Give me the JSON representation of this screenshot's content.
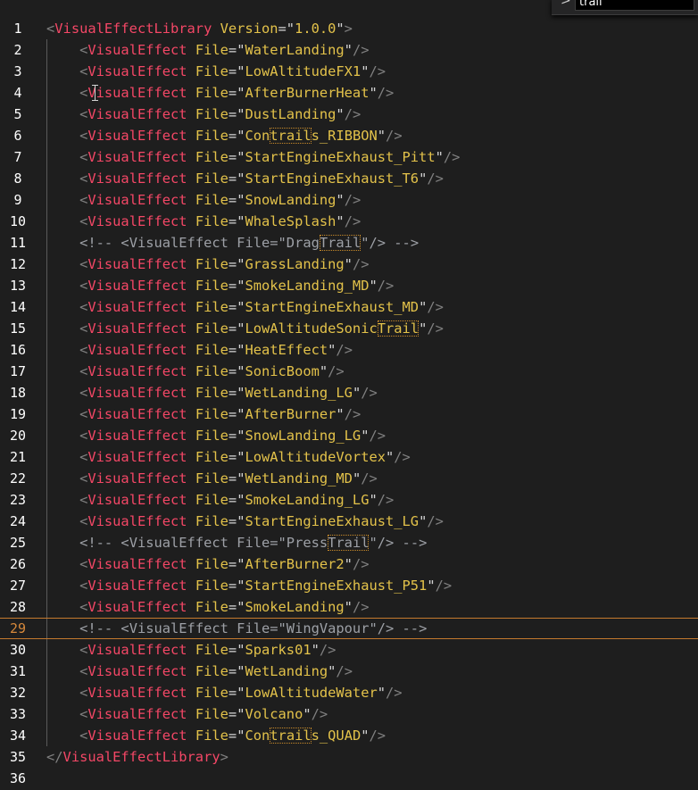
{
  "find": {
    "query": "trail",
    "toggle_icon": "chevron-right-icon",
    "toggle_glyph": ">"
  },
  "current_line": 29,
  "colors": {
    "background": "#1e1e1e",
    "tag": "#f44766",
    "attribute": "#e3c24a",
    "comment": "#9da0a6",
    "current_line_number": "#d7893b"
  },
  "lines": [
    {
      "n": "1",
      "kind": "open",
      "tag": "VisualEffectLibrary",
      "attr": "Version",
      "value": "1.0.0"
    },
    {
      "n": "2",
      "kind": "item",
      "tag": "VisualEffect",
      "attr": "File",
      "value": "WaterLanding"
    },
    {
      "n": "3",
      "kind": "item",
      "tag": "VisualEffect",
      "attr": "File",
      "value": "LowAltitudeFX1"
    },
    {
      "n": "4",
      "kind": "item",
      "tag": "VisualEffect",
      "attr": "File",
      "value": "AfterBurnerHeat"
    },
    {
      "n": "5",
      "kind": "item",
      "tag": "VisualEffect",
      "attr": "File",
      "value": "DustLanding"
    },
    {
      "n": "6",
      "kind": "item",
      "tag": "VisualEffect",
      "attr": "File",
      "value": "Contrails_RIBBON",
      "match": "trail"
    },
    {
      "n": "7",
      "kind": "item",
      "tag": "VisualEffect",
      "attr": "File",
      "value": "StartEngineExhaust_Pitt"
    },
    {
      "n": "8",
      "kind": "item",
      "tag": "VisualEffect",
      "attr": "File",
      "value": "StartEngineExhaust_T6"
    },
    {
      "n": "9",
      "kind": "item",
      "tag": "VisualEffect",
      "attr": "File",
      "value": "SnowLanding"
    },
    {
      "n": "10",
      "kind": "item",
      "tag": "VisualEffect",
      "attr": "File",
      "value": "WhaleSplash"
    },
    {
      "n": "11",
      "kind": "comment",
      "tag": "VisualEffect",
      "attr": "File",
      "value": "DragTrail",
      "match": "Trail"
    },
    {
      "n": "12",
      "kind": "item",
      "tag": "VisualEffect",
      "attr": "File",
      "value": "GrassLanding"
    },
    {
      "n": "13",
      "kind": "item",
      "tag": "VisualEffect",
      "attr": "File",
      "value": "SmokeLanding_MD"
    },
    {
      "n": "14",
      "kind": "item",
      "tag": "VisualEffect",
      "attr": "File",
      "value": "StartEngineExhaust_MD"
    },
    {
      "n": "15",
      "kind": "item",
      "tag": "VisualEffect",
      "attr": "File",
      "value": "LowAltitudeSonicTrail",
      "match": "Trail"
    },
    {
      "n": "16",
      "kind": "item",
      "tag": "VisualEffect",
      "attr": "File",
      "value": "HeatEffect"
    },
    {
      "n": "17",
      "kind": "item",
      "tag": "VisualEffect",
      "attr": "File",
      "value": "SonicBoom"
    },
    {
      "n": "18",
      "kind": "item",
      "tag": "VisualEffect",
      "attr": "File",
      "value": "WetLanding_LG"
    },
    {
      "n": "19",
      "kind": "item",
      "tag": "VisualEffect",
      "attr": "File",
      "value": "AfterBurner"
    },
    {
      "n": "20",
      "kind": "item",
      "tag": "VisualEffect",
      "attr": "File",
      "value": "SnowLanding_LG"
    },
    {
      "n": "21",
      "kind": "item",
      "tag": "VisualEffect",
      "attr": "File",
      "value": "LowAltitudeVortex"
    },
    {
      "n": "22",
      "kind": "item",
      "tag": "VisualEffect",
      "attr": "File",
      "value": "WetLanding_MD"
    },
    {
      "n": "23",
      "kind": "item",
      "tag": "VisualEffect",
      "attr": "File",
      "value": "SmokeLanding_LG"
    },
    {
      "n": "24",
      "kind": "item",
      "tag": "VisualEffect",
      "attr": "File",
      "value": "StartEngineExhaust_LG"
    },
    {
      "n": "25",
      "kind": "comment",
      "tag": "VisualEffect",
      "attr": "File",
      "value": "PressTrail",
      "match": "Trail"
    },
    {
      "n": "26",
      "kind": "item",
      "tag": "VisualEffect",
      "attr": "File",
      "value": "AfterBurner2"
    },
    {
      "n": "27",
      "kind": "item",
      "tag": "VisualEffect",
      "attr": "File",
      "value": "StartEngineExhaust_P51"
    },
    {
      "n": "28",
      "kind": "item",
      "tag": "VisualEffect",
      "attr": "File",
      "value": "SmokeLanding"
    },
    {
      "n": "29",
      "kind": "comment",
      "tag": "VisualEffect",
      "attr": "File",
      "value": "WingVapour"
    },
    {
      "n": "30",
      "kind": "item",
      "tag": "VisualEffect",
      "attr": "File",
      "value": "Sparks01"
    },
    {
      "n": "31",
      "kind": "item",
      "tag": "VisualEffect",
      "attr": "File",
      "value": "WetLanding"
    },
    {
      "n": "32",
      "kind": "item",
      "tag": "VisualEffect",
      "attr": "File",
      "value": "LowAltitudeWater"
    },
    {
      "n": "33",
      "kind": "item",
      "tag": "VisualEffect",
      "attr": "File",
      "value": "Volcano"
    },
    {
      "n": "34",
      "kind": "item",
      "tag": "VisualEffect",
      "attr": "File",
      "value": "Contrails_QUAD",
      "match": "trail"
    },
    {
      "n": "35",
      "kind": "close",
      "tag": "VisualEffectLibrary"
    },
    {
      "n": "36",
      "kind": "empty"
    }
  ]
}
